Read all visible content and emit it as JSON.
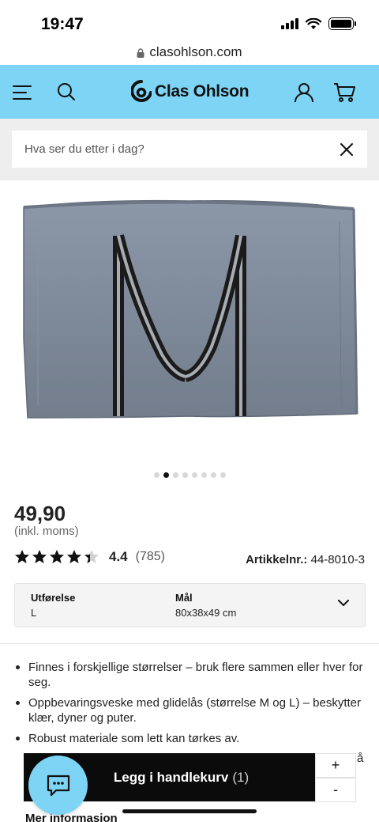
{
  "status_bar": {
    "time": "19:47"
  },
  "browser": {
    "url": "clasohlson.com"
  },
  "header": {
    "brand": "Clas Ohlson",
    "accent_color": "#7dd4f5"
  },
  "search": {
    "placeholder": "Hva ser du etter i dag?"
  },
  "gallery": {
    "image_count": 8,
    "active_index": 1
  },
  "product": {
    "price": "49,90",
    "price_note": "(inkl. moms)",
    "rating_value": "4.4",
    "rating_stars": 4.4,
    "rating_count": "(785)",
    "article_label": "Artikkelnr.:",
    "article_number": "44-8010-3"
  },
  "variant": {
    "label_1": "Utførelse",
    "value_1": "L",
    "label_2": "Mål",
    "value_2": "80x38x49 cm"
  },
  "features": [
    "Finnes i forskjellige størrelser – bruk flere sammen eller hver for seg.",
    "Oppbevaringsveske med glidelås (størrelse M og L) – beskytter klær, dyner og puter.",
    "Robust materiale som lett kan tørkes av."
  ],
  "partial_char": "å",
  "more_info": "Mer informasjon",
  "cart": {
    "label": "Legg i handlekurv",
    "count": "(1)",
    "plus": "+",
    "minus": "-"
  }
}
